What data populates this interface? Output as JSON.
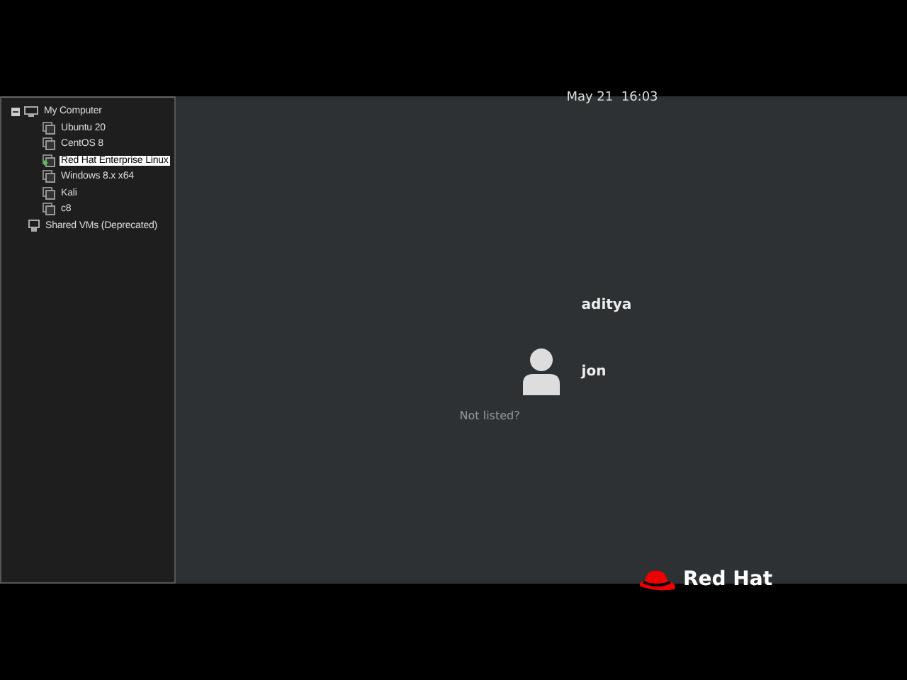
{
  "sidebar": {
    "root": {
      "label": "My Computer",
      "expanded": true,
      "children": [
        {
          "label": "Ubuntu 20",
          "selected": false,
          "running": false
        },
        {
          "label": "CentOS 8",
          "selected": false,
          "running": false
        },
        {
          "label": "Red Hat Enterprise Linux",
          "selected": true,
          "running": true
        },
        {
          "label": "Windows 8.x x64",
          "selected": false,
          "running": false
        },
        {
          "label": "Kali",
          "selected": false,
          "running": false
        },
        {
          "label": "c8",
          "selected": false,
          "running": false
        }
      ]
    },
    "shared": {
      "label": "Shared VMs (Deprecated)"
    }
  },
  "login": {
    "clock": "May 21  16:03",
    "users": [
      {
        "name": "aditya",
        "avatar": false
      },
      {
        "name": "jon",
        "avatar": true
      }
    ],
    "not_listed": "Not listed?",
    "brand": "Red Hat"
  }
}
